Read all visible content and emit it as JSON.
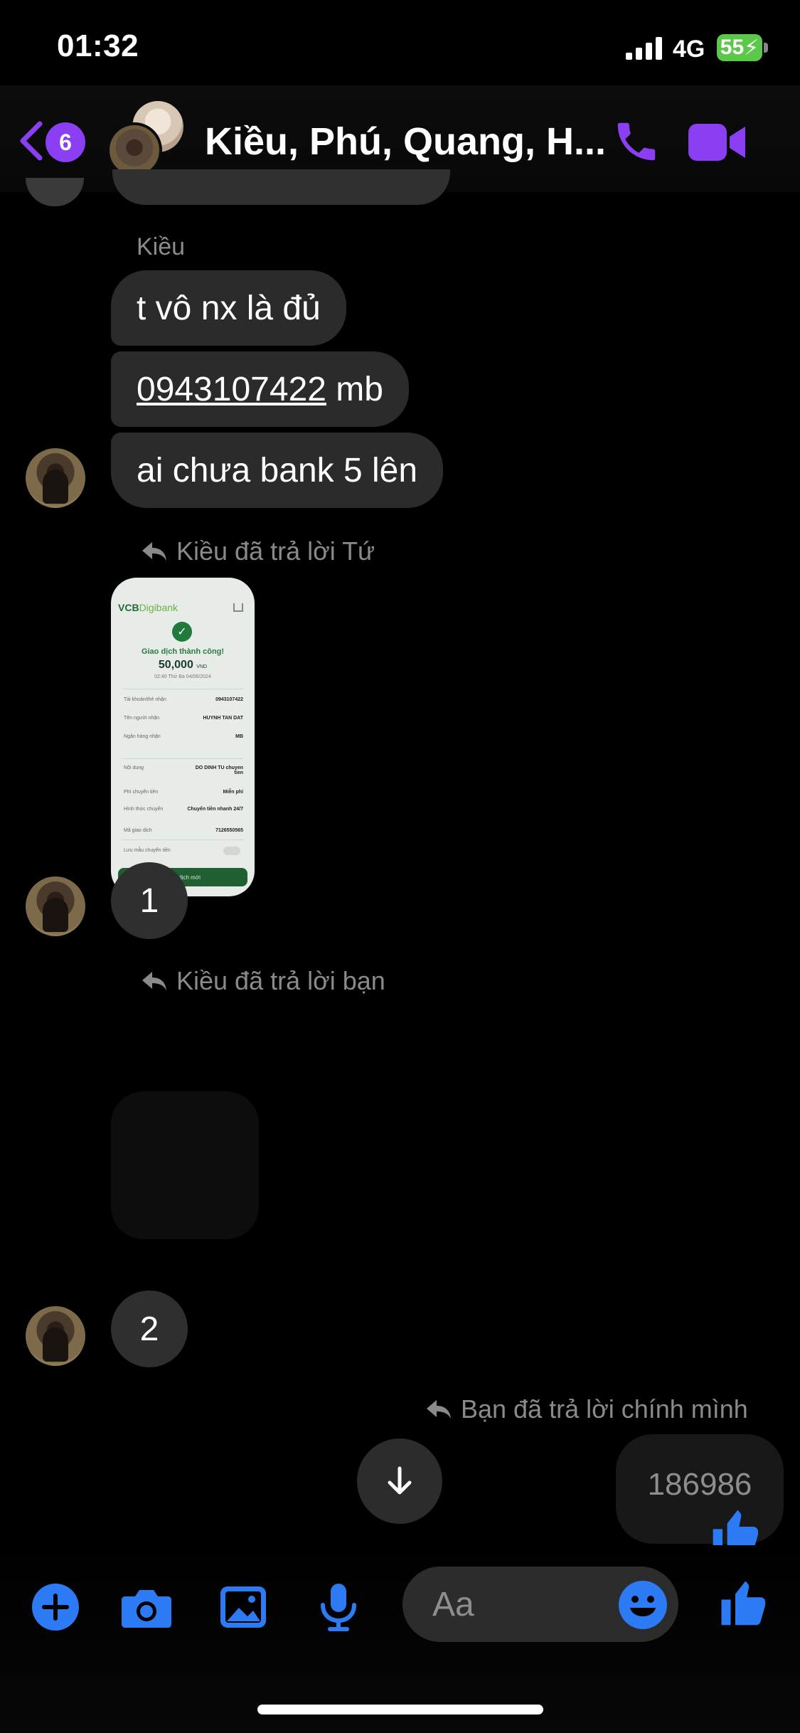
{
  "status_bar": {
    "time": "01:32",
    "network": "4G",
    "battery": "55"
  },
  "header": {
    "back_count": "6",
    "title": "Kiều, Phú, Quang, H..."
  },
  "messages": {
    "sender_name": "Kiều",
    "bubble_1": "t vô nx là đủ",
    "bubble_2_phone": "0943107422",
    "bubble_2_suffix": " mb",
    "bubble_3": "ai chưa bank 5 lên",
    "reply_1": "Kiều đã trả lời Tứ",
    "reply_2": "Kiều đã trả lời bạn",
    "reply_3": "Bạn đã trả lời chính mình",
    "num_1": "1",
    "num_2": "2",
    "my_message": "186986"
  },
  "receipt": {
    "brand": "VCB",
    "brand_sub": "Digibank",
    "success": "Giao dịch thành công!",
    "amount": "50,000",
    "currency": "VND",
    "time": "02:40 Thứ Ba 04/06/2024",
    "rows": [
      {
        "label": "Tài khoản/thẻ nhận",
        "value": "0943107422"
      },
      {
        "label": "Tên người nhận",
        "value": "HUYNH TAN DAT"
      },
      {
        "label": "Ngân hàng nhận",
        "value": "MB"
      },
      {
        "label": "Nội dung",
        "value": "DO DINH TU chuyen tien"
      },
      {
        "label": "Phí chuyển tiền",
        "value": "Miễn phí"
      },
      {
        "label": "Hình thức chuyển",
        "value": "Chuyển tiền nhanh 24/7"
      },
      {
        "label": "Mã giao dịch",
        "value": "7126550565"
      },
      {
        "label": "Lưu mẫu chuyển tiền",
        "value": ""
      }
    ],
    "button": "Giao dịch mới"
  },
  "composer": {
    "placeholder": "Aa"
  },
  "colors": {
    "accent": "#8a3ff2",
    "blue": "#2d7bf4",
    "bubble": "#2b2b2b"
  }
}
